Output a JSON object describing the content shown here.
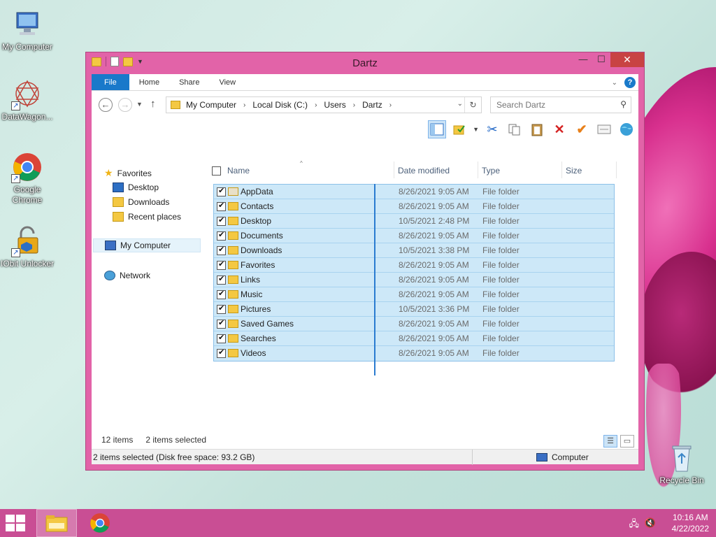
{
  "desktop": {
    "icons": [
      {
        "label": "My Computer"
      },
      {
        "label": "DataWagon..."
      },
      {
        "label": "Google Chrome"
      },
      {
        "label": "IObit Unlocker"
      },
      {
        "label": "Recycle Bin"
      }
    ]
  },
  "window": {
    "title": "Dartz",
    "ribbon_tabs": [
      "File",
      "Home",
      "Share",
      "View"
    ],
    "help": "?",
    "address": {
      "crumbs": [
        "My Computer",
        "Local Disk (C:)",
        "Users",
        "Dartz"
      ]
    },
    "search": {
      "placeholder": "Search Dartz"
    },
    "nav": {
      "favorites": "Favorites",
      "desktop": "Desktop",
      "downloads": "Downloads",
      "recent": "Recent places",
      "my_computer": "My Computer",
      "network": "Network"
    },
    "columns": {
      "name": "Name",
      "date": "Date modified",
      "type": "Type",
      "size": "Size"
    },
    "files": [
      {
        "name": "AppData",
        "date": "8/26/2021 9:05 AM",
        "type": "File folder"
      },
      {
        "name": "Contacts",
        "date": "8/26/2021 9:05 AM",
        "type": "File folder"
      },
      {
        "name": "Desktop",
        "date": "10/5/2021 2:48 PM",
        "type": "File folder"
      },
      {
        "name": "Documents",
        "date": "8/26/2021 9:05 AM",
        "type": "File folder"
      },
      {
        "name": "Downloads",
        "date": "10/5/2021 3:38 PM",
        "type": "File folder"
      },
      {
        "name": "Favorites",
        "date": "8/26/2021 9:05 AM",
        "type": "File folder"
      },
      {
        "name": "Links",
        "date": "8/26/2021 9:05 AM",
        "type": "File folder"
      },
      {
        "name": "Music",
        "date": "8/26/2021 9:05 AM",
        "type": "File folder"
      },
      {
        "name": "Pictures",
        "date": "10/5/2021 3:36 PM",
        "type": "File folder"
      },
      {
        "name": "Saved Games",
        "date": "8/26/2021 9:05 AM",
        "type": "File folder"
      },
      {
        "name": "Searches",
        "date": "8/26/2021 9:05 AM",
        "type": "File folder"
      },
      {
        "name": "Videos",
        "date": "8/26/2021 9:05 AM",
        "type": "File folder"
      }
    ],
    "status": {
      "count": "12 items",
      "selected": "2 items selected",
      "detail": "2 items selected (Disk free space: 93.2 GB)",
      "location": "Computer"
    }
  },
  "taskbar": {
    "time": "10:16 AM",
    "date": "4/22/2022"
  },
  "colors": {
    "accent": "#e263a8",
    "taskbar": "#c94e94",
    "selection": "#cde8f8",
    "file_tab": "#1979ca"
  }
}
